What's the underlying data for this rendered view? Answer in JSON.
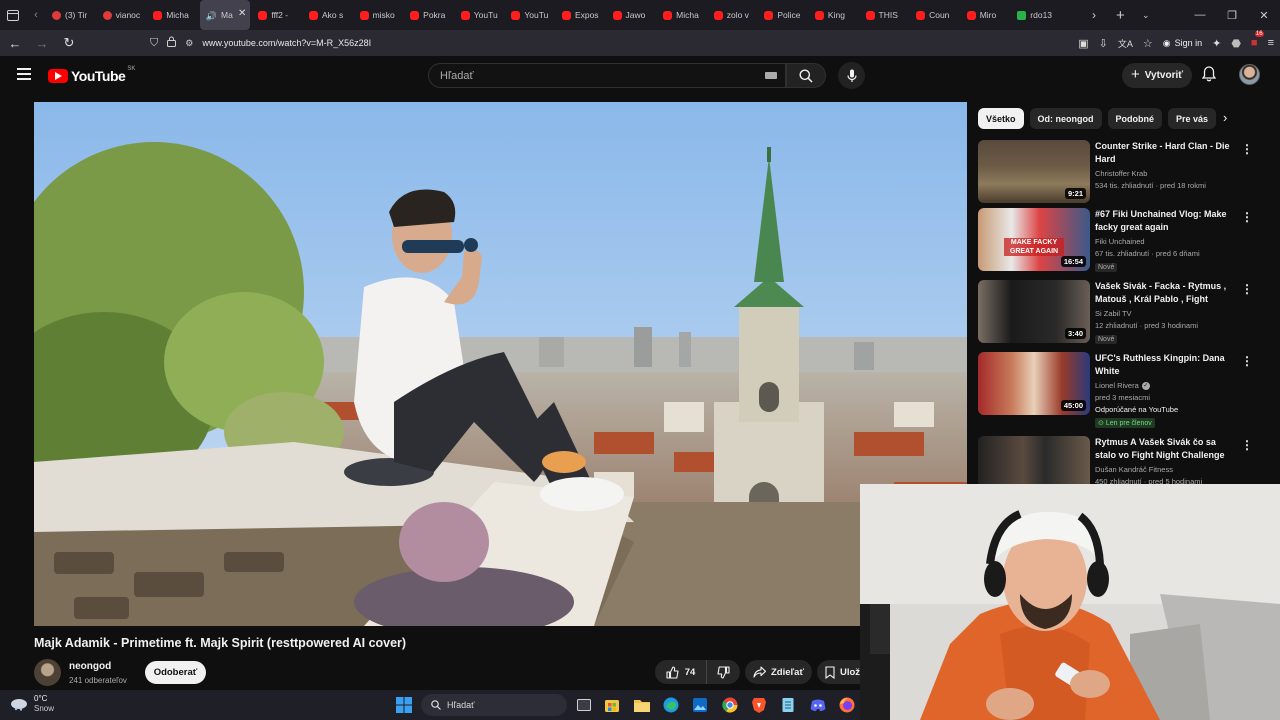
{
  "browser": {
    "tabs": [
      {
        "label": "(3) Tir",
        "icon": "reddit-icon"
      },
      {
        "label": "vianoc",
        "icon": "reddit-icon"
      },
      {
        "label": "Micha",
        "icon": "youtube-icon"
      },
      {
        "label": "Ma",
        "icon": "speaker-icon",
        "active": true
      },
      {
        "label": "fff2 -",
        "icon": "youtube-icon"
      },
      {
        "label": "Ako s",
        "icon": "youtube-icon"
      },
      {
        "label": "misko",
        "icon": "youtube-icon"
      },
      {
        "label": "Pokra",
        "icon": "youtube-icon"
      },
      {
        "label": "YouTu",
        "icon": "youtube-icon"
      },
      {
        "label": "YouTu",
        "icon": "youtube-icon"
      },
      {
        "label": "Expos",
        "icon": "youtube-icon"
      },
      {
        "label": "Jawo",
        "icon": "youtube-icon"
      },
      {
        "label": "Micha",
        "icon": "youtube-icon"
      },
      {
        "label": "zolo v",
        "icon": "youtube-icon"
      },
      {
        "label": "Police",
        "icon": "youtube-icon"
      },
      {
        "label": "King",
        "icon": "youtube-icon"
      },
      {
        "label": "THIS",
        "icon": "youtube-icon"
      },
      {
        "label": "Coun",
        "icon": "youtube-icon"
      },
      {
        "label": "Miro",
        "icon": "youtube-icon"
      },
      {
        "label": "rdo13",
        "icon": "green-k-icon"
      }
    ],
    "url": "www.youtube.com/watch?v=M-R_X56z28I",
    "signin_label": "Sign in",
    "ext_badge": "16"
  },
  "masthead": {
    "logo_text": "YouTube",
    "country_code": "SK",
    "search_placeholder": "Hľadať",
    "create_label": "Vytvoriť"
  },
  "video": {
    "title": "Majk Adamik - Primetime ft. Majk Spirit (resttpowered AI cover)",
    "channel_name": "neongod",
    "channel_subs": "241 odberateľov",
    "subscribe_label": "Odoberať",
    "likes": "74",
    "share_label": "Zdieľať",
    "save_label": "Uložiť"
  },
  "chips": [
    "Všetko",
    "Od: neongod",
    "Podobné",
    "Pre vás"
  ],
  "recommendations": [
    {
      "title": "Counter Strike - Hard Clan - Die Hard",
      "channel": "Christoffer Krab",
      "meta": "534 tis. zhliadnutí · pred 18 rokmi",
      "duration": "9:21"
    },
    {
      "title": "#67 Fiki Unchained Vlog: Make facky great again",
      "channel": "Fiki Unchained",
      "meta": "67 tis. zhliadnutí · pred 6 dňami",
      "duration": "16:54",
      "badge": "Nové",
      "thumb_text": "MAKE FACKY GREAT AGAIN"
    },
    {
      "title": "Vašek Sivák - Facka - Rytmus , Matouš , Král Pablo , Fight night...",
      "channel": "Si Zabil TV",
      "meta": "12 zhliadnutí · pred 3 hodinami",
      "duration": "3:40",
      "badge": "Nové"
    },
    {
      "title": "UFC's Ruthless Kingpin: Dana White",
      "channel": "Lionel Rivera",
      "verified": true,
      "meta": "pred 3 mesiacmi",
      "duration": "45:00",
      "recommended": "Odporúčané na YouTube",
      "member": "Len pre členov"
    },
    {
      "title": "Rytmus A Vašek Sivák čo sa stalo vo Fight Night Challenge",
      "channel": "Dušan Kandráč Fitness",
      "meta": "450 zhliadnutí · pred 5 hodinami",
      "duration": ""
    }
  ],
  "taskbar": {
    "temperature": "0°C",
    "condition": "Snow",
    "search_placeholder": "Hľadať"
  }
}
